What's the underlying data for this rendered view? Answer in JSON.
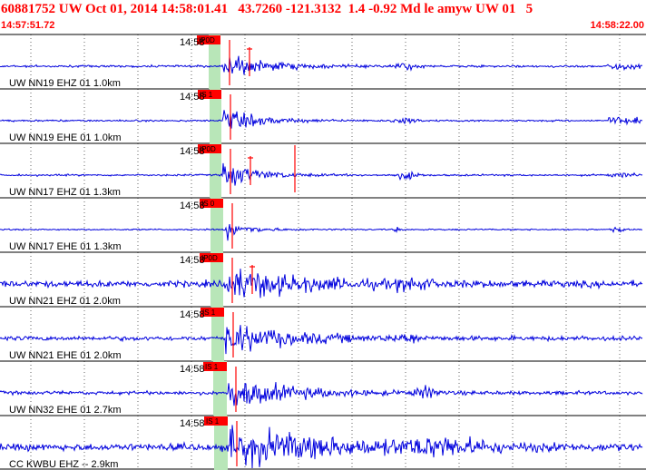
{
  "header": {
    "title": "60881752 UW Oct 01, 2014 14:58:01.41   43.7260 -121.3132  1.4 -0.92 Md le amyw UW 01   5",
    "time_start": "14:57:51.72",
    "time_end": "14:58:22.00"
  },
  "colors": {
    "trace": "#0000dd",
    "pick": "#ff0000",
    "grid": "#666666",
    "highlight": "#b8e6b8",
    "header_text": "#ff0000"
  },
  "channels": [
    {
      "label": "UW NN19 EHZ 01 1.0km",
      "minute_label": "14:58",
      "pick_tag": "IP0D",
      "s_pick": true
    },
    {
      "label": "UW NN19 EHE 01 1.0km",
      "minute_label": "14:58",
      "pick_tag": "IS 1",
      "s_pick": false
    },
    {
      "label": "UW NN17 EHZ 01 1.3km",
      "minute_label": "14:58",
      "pick_tag": "IP0D",
      "s_pick": true
    },
    {
      "label": "UW NN17 EHE 01 1.3km",
      "minute_label": "14:58",
      "pick_tag": "IS 0",
      "s_pick": false
    },
    {
      "label": "UW NN21 EHZ 01 2.0km",
      "minute_label": "14:58",
      "pick_tag": "IP0D",
      "s_pick": true
    },
    {
      "label": "UW NN21 EHE 01 2.0km",
      "minute_label": "14:58",
      "pick_tag": "IS 1",
      "s_pick": false
    },
    {
      "label": "UW NN32 EHE 01 2.7km",
      "minute_label": "14:58",
      "pick_tag": "IS 1",
      "s_pick": false
    },
    {
      "label": "CC KWBU EHZ -- 2.9km",
      "minute_label": "14:58",
      "pick_tag": "IS 1",
      "s_pick": false
    }
  ]
}
